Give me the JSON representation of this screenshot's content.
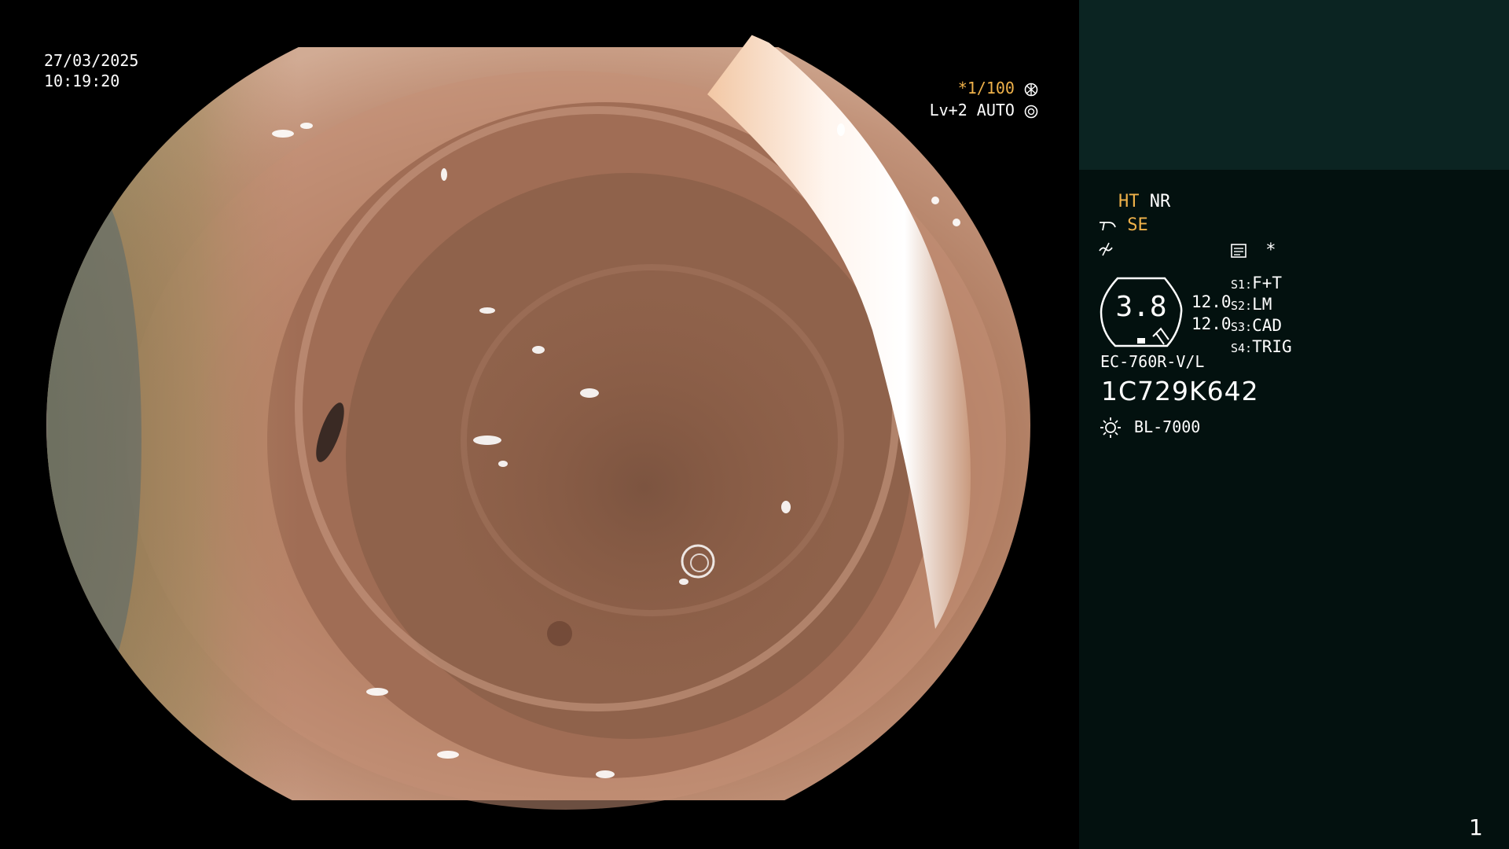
{
  "screen": {
    "width": 1920,
    "height": 1080
  },
  "overlay": {
    "date": "27/03/2025",
    "time": "10:19:20",
    "shutter": "*1/100",
    "iris": "Lv+2 AUTO"
  },
  "panel": {
    "ht": "HT",
    "nr": "NR",
    "se": "SE",
    "brightness": "3.8",
    "level_1": "12.0",
    "level_2": "12.0",
    "switches": [
      {
        "key": "S1:",
        "value": "F+T"
      },
      {
        "key": "S2:",
        "value": "LM"
      },
      {
        "key": "S3:",
        "value": "CAD"
      },
      {
        "key": "S4:",
        "value": "TRIG"
      }
    ],
    "scope_model": "EC-760R-V/L",
    "scope_serial": "1C729K642",
    "light_source": "BL-7000",
    "frame_number": "1",
    "star": "*"
  },
  "colors": {
    "panel_top": "#0b2422",
    "panel_body": "#03110f",
    "accent_yellow": "#f0b24a",
    "mucosa": "#b98768"
  },
  "icons": [
    "aperture-icon",
    "iris-icon",
    "scope-bend-icon",
    "tilde-icon",
    "memo-icon",
    "sun-icon"
  ]
}
